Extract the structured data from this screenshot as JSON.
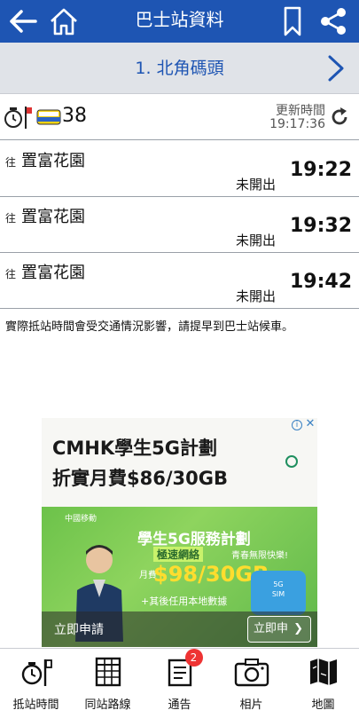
{
  "header": {
    "title": "巴士站資料"
  },
  "stop": {
    "name": "1. 北角碼頭"
  },
  "route": {
    "number": "38",
    "update_label": "更新時間",
    "update_time": "19:17:36"
  },
  "etas": [
    {
      "to_prefix": "往",
      "destination": "置富花園",
      "status": "未開出",
      "time": "19:22"
    },
    {
      "to_prefix": "往",
      "destination": "置富花園",
      "status": "未開出",
      "time": "19:32"
    },
    {
      "to_prefix": "往",
      "destination": "置富花園",
      "status": "未開出",
      "time": "19:42"
    }
  ],
  "notice": "實際抵站時間會受交通情況影響，請提早到巴士站候車。",
  "ad": {
    "line1": "CMHK學生5G計劃",
    "line2": "折實月費$86/30GB",
    "brand": "中國移動",
    "service": "學生5G服務計劃",
    "speed": "極速網絡",
    "slogan": "青春無限快樂!",
    "monthly_fee_label": "月費",
    "price": "$98/30GB",
    "local_data": "+其後任用本地數據",
    "cta_left": "立即申請",
    "cta_right": "立即申",
    "accent_color": "#6cc24a"
  },
  "nav": {
    "items": [
      {
        "label": "抵站時間",
        "icon": "clock-stop-icon"
      },
      {
        "label": "同站路線",
        "icon": "grid-table-icon"
      },
      {
        "label": "通告",
        "icon": "notice-icon",
        "badge": "2"
      },
      {
        "label": "相片",
        "icon": "camera-icon"
      },
      {
        "label": "地圖",
        "icon": "map-icon"
      }
    ]
  },
  "colors": {
    "primary": "#1e55b3",
    "stopbar_bg": "#e0e3e8"
  }
}
